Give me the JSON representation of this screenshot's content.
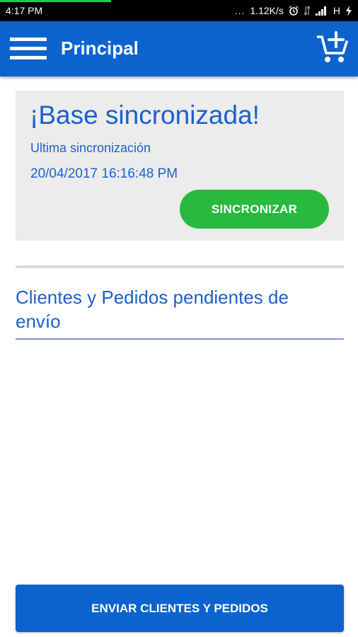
{
  "status_bar": {
    "time": "4:17 PM",
    "dots": "...",
    "speed": "1.12K/s",
    "network": "H",
    "progress_fraction": 0.31
  },
  "app_bar": {
    "title": "Principal",
    "menu_icon": "hamburger-menu-icon",
    "cart_icon": "add-to-cart-icon"
  },
  "sync_card": {
    "title": "¡Base sincronizada!",
    "last_sync_label": "Ultima sincronización",
    "last_sync_date": "20/04/2017 16:16:48 PM",
    "button_label": "SINCRONIZAR"
  },
  "pending": {
    "title": "Clientes y Pedidos pendientes de envío"
  },
  "footer": {
    "send_label": "ENVIAR CLIENTES Y PEDIDOS"
  },
  "colors": {
    "primary": "#0a63cf",
    "accent_green": "#27ba3e",
    "text_blue": "#1b5fcf",
    "card_bg": "#ececec"
  }
}
